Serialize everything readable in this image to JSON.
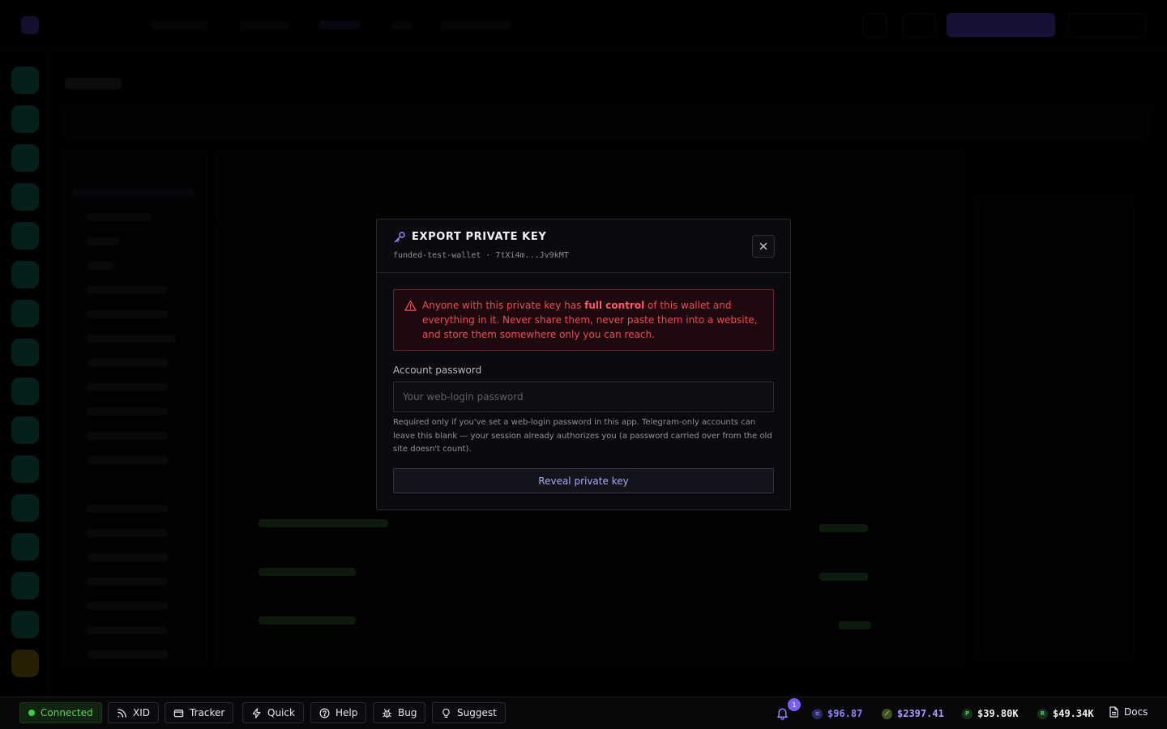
{
  "modal": {
    "title": "EXPORT PRIVATE KEY",
    "subtitle": "funded-test-wallet · 7tXi4m...Jv9kMT",
    "warning": {
      "before": "Anyone with this private key has ",
      "bold": "full control",
      "after": " of this wallet and everything in it. Never share them, never paste them into a website, and store them somewhere only you can reach."
    },
    "password_label": "Account password",
    "password_placeholder": "Your web-login password",
    "password_value": "",
    "help": "Required only if you've set a web-login password in this app. Telegram-only accounts can leave this blank — your session already authorizes you (a password carried over from the old site doesn't count).",
    "reveal_label": "Reveal private key",
    "icons": {
      "title": "key-icon",
      "close": "close-icon",
      "warning": "warning-triangle-icon"
    }
  },
  "statusbar": {
    "connection": "Connected",
    "buttons": [
      {
        "label": "XID",
        "icon": "signal-icon"
      },
      {
        "label": "Tracker",
        "icon": "wallet-icon"
      },
      {
        "label": "Quick",
        "icon": "bolt-icon"
      },
      {
        "label": "Help",
        "icon": "help-icon"
      },
      {
        "label": "Bug",
        "icon": "bug-icon"
      },
      {
        "label": "Suggest",
        "icon": "lightbulb-icon"
      }
    ],
    "notifications": "1",
    "prices": [
      {
        "value": "$96.87",
        "color": "#8f84ff",
        "coin_color": "#2b2b5a",
        "glyph": "≡"
      },
      {
        "value": "$2397.41",
        "color": "#a99cff",
        "coin_color": "#3d5220",
        "glyph": "⟋"
      },
      {
        "value": "$39.80K",
        "color": "#f0f0f0",
        "coin_color": "#16331a",
        "glyph": "P"
      },
      {
        "value": "$49.34K",
        "color": "#f0f0f0",
        "coin_color": "#16331a",
        "glyph": "R"
      }
    ],
    "docs": "Docs"
  },
  "colors": {
    "accent": "#7c5cf5",
    "danger": "#ee4b5b",
    "success": "#3ecf4a"
  }
}
